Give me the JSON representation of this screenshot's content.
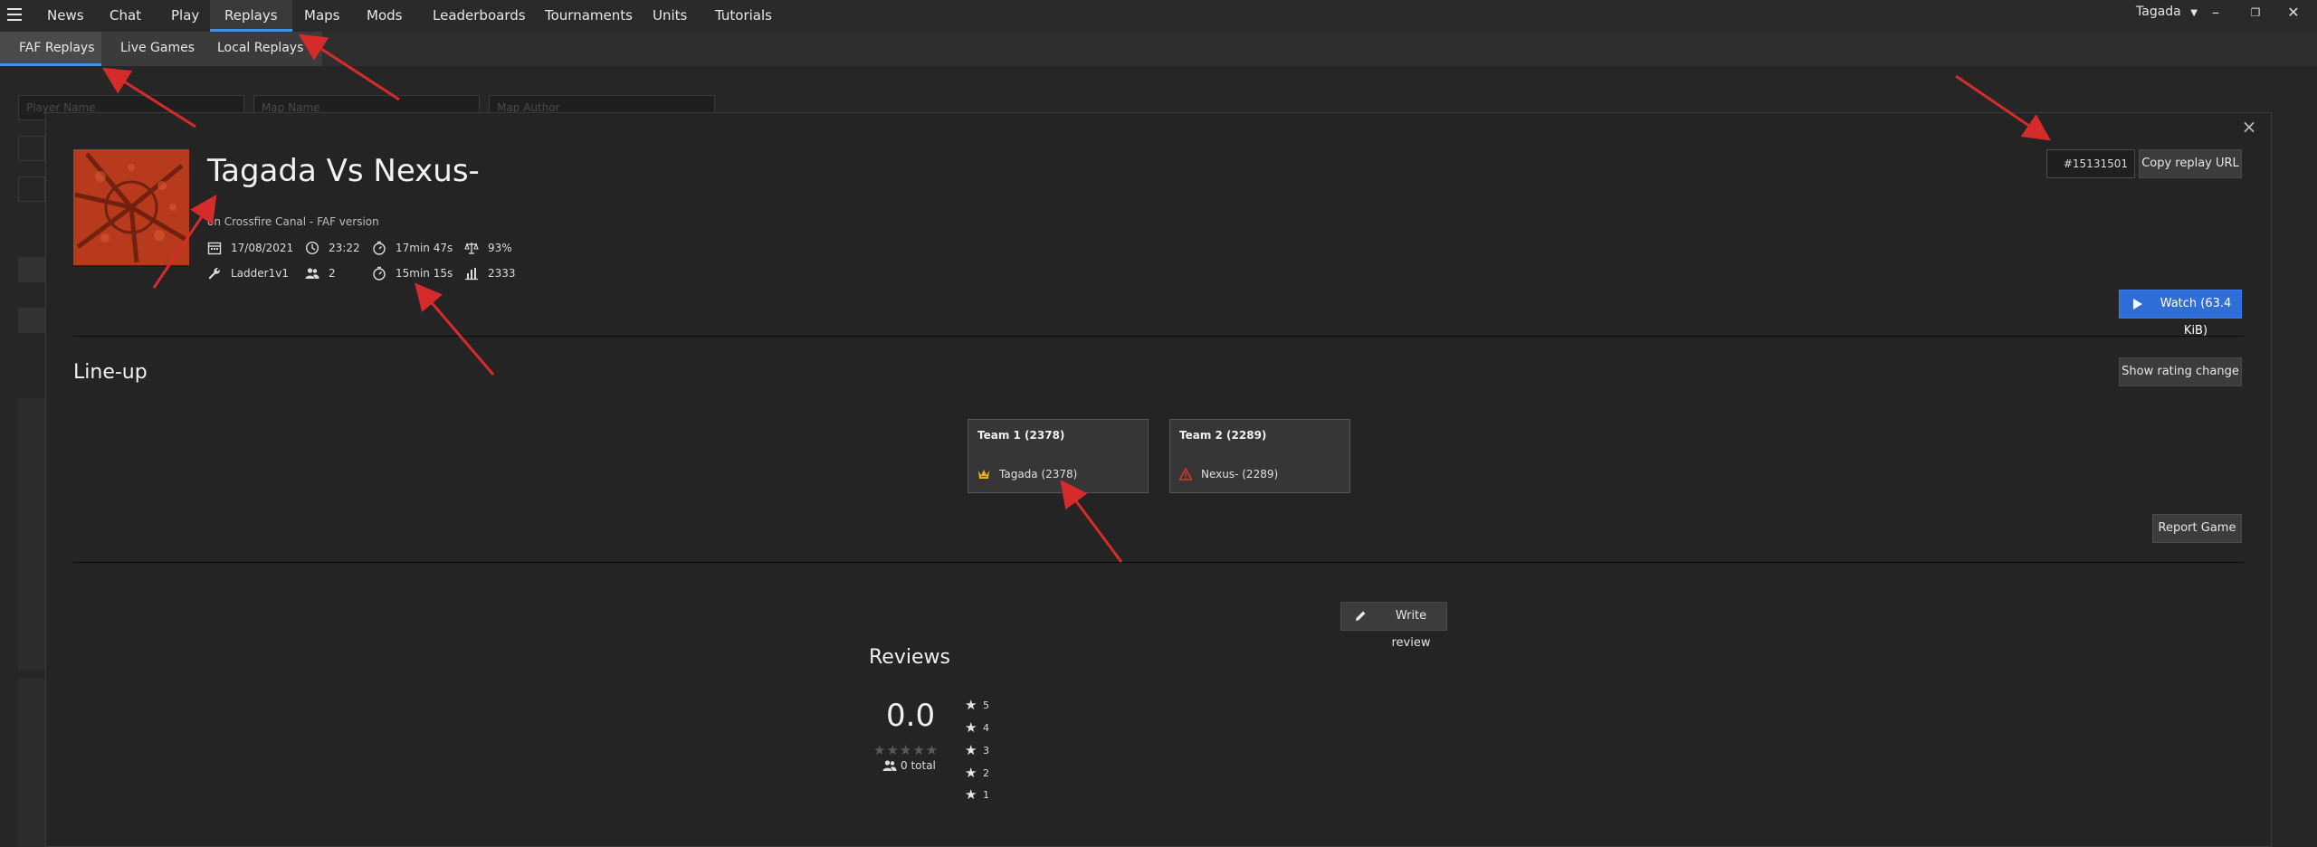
{
  "nav": {
    "items": [
      "News",
      "Chat",
      "Play",
      "Replays",
      "Maps",
      "Mods",
      "Leaderboards",
      "Tournaments",
      "Units",
      "Tutorials"
    ],
    "active": "Replays",
    "user": "Tagada"
  },
  "subnav": {
    "items": [
      "FAF Replays",
      "Live Games",
      "Local Replays"
    ],
    "active": "FAF Replays"
  },
  "background": {
    "player_name_placeholder": "Player Name",
    "map_name_placeholder": "Map Name",
    "map_author_placeholder": "Map Author"
  },
  "replay": {
    "title": "Tagada Vs Nexus-",
    "subtitle": "on Crossfire Canal - FAF version",
    "date": "17/08/2021",
    "time": "23:22",
    "duration": "17min 47s",
    "quality": "93%",
    "featured_mod": "Ladder1v1",
    "player_count": "2",
    "real_duration": "15min 15s",
    "avg_rating": "2333",
    "id": "#15131501",
    "copy_url_label": "Copy replay URL",
    "watch_label": "Watch (63.4 KiB)"
  },
  "lineup": {
    "title": "Line-up",
    "show_rating_label": "Show rating change",
    "report_label": "Report Game",
    "teams": [
      {
        "title": "Team 1 (2378)",
        "player": "Tagada (2378)",
        "faction": "aeon"
      },
      {
        "title": "Team 2 (2289)",
        "player": "Nexus- (2289)",
        "faction": "cybran"
      }
    ]
  },
  "reviews": {
    "title": "Reviews",
    "write_label": "Write review",
    "score": "0.0",
    "stars": "★★★★★",
    "total": "0 total",
    "star_levels": [
      "5",
      "4",
      "3",
      "2",
      "1"
    ]
  },
  "colors": {
    "accent": "#4a90e2",
    "watch": "#2f6ed6",
    "annotation": "#d62b2b"
  },
  "icons": [
    "menu-icon",
    "calendar-icon",
    "clock-icon",
    "timer-icon",
    "balance-icon",
    "wrench-icon",
    "users-icon",
    "chart-icon",
    "play-icon",
    "pencil-icon",
    "star-icon",
    "close-icon"
  ]
}
